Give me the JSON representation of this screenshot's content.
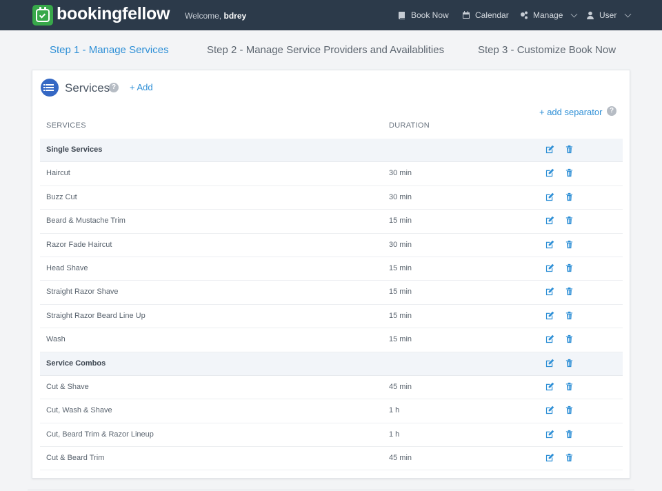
{
  "header": {
    "brand": "bookingfellow",
    "welcome_prefix": "Welcome,",
    "username": "bdrey",
    "nav": [
      {
        "label": "Book Now",
        "icon": "book-icon"
      },
      {
        "label": "Calendar",
        "icon": "calendar-icon"
      },
      {
        "label": "Manage",
        "icon": "cogs-icon"
      },
      {
        "label": "User",
        "icon": "user-icon"
      }
    ]
  },
  "steps": [
    {
      "label": "Step 1 - Manage Services",
      "active": true
    },
    {
      "label": "Step 2 - Manage Service Providers and Availablities",
      "active": false
    },
    {
      "label": "Step 3 - Customize Book Now",
      "active": false
    }
  ],
  "card": {
    "title": "Services",
    "help": "?",
    "add_label": "+ Add",
    "add_separator_label": "+ add separator",
    "columns": {
      "services": "SERVICES",
      "duration": "DURATION"
    }
  },
  "rows": [
    {
      "name": "Single Services",
      "duration": "",
      "group": true
    },
    {
      "name": "Haircut",
      "duration": "30 min"
    },
    {
      "name": "Buzz Cut",
      "duration": "30 min"
    },
    {
      "name": "Beard & Mustache Trim",
      "duration": "15 min"
    },
    {
      "name": "Razor Fade Haircut",
      "duration": "30 min"
    },
    {
      "name": "Head Shave",
      "duration": "15 min"
    },
    {
      "name": "Straight Razor Shave",
      "duration": "15 min"
    },
    {
      "name": "Straight Razor Beard Line Up",
      "duration": "15 min"
    },
    {
      "name": "Wash",
      "duration": "15 min"
    },
    {
      "name": "Service Combos",
      "duration": "",
      "group": true
    },
    {
      "name": "Cut & Shave",
      "duration": "45 min"
    },
    {
      "name": "Cut, Wash & Shave",
      "duration": "1 h"
    },
    {
      "name": "Cut, Beard Trim & Razor Lineup",
      "duration": "1 h"
    },
    {
      "name": "Cut & Beard Trim",
      "duration": "45 min"
    }
  ],
  "colors": {
    "accent": "#2e8fd6",
    "topbar": "#2c3a4a",
    "logo": "#38a84a",
    "icon": "#2e8fd6"
  }
}
